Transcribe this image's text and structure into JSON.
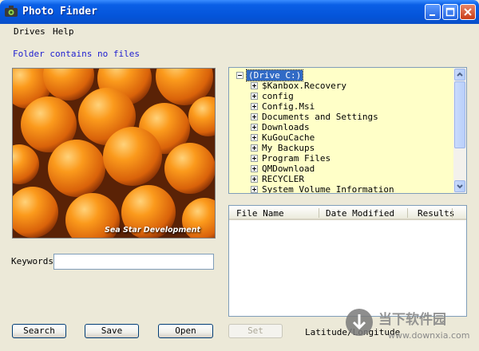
{
  "window": {
    "title": "Photo Finder"
  },
  "menu": {
    "items": [
      "Drives",
      "Help"
    ]
  },
  "status": {
    "text": "Folder contains no files"
  },
  "photo": {
    "caption": "Sea Star Development"
  },
  "keywords": {
    "label": "Keywords",
    "value": ""
  },
  "buttons": {
    "search": "Search",
    "save": "Save",
    "open": "Open",
    "set": "Set"
  },
  "tree": {
    "root": "Drive C:",
    "items": [
      "$Kanbox.Recovery",
      "config",
      "Config.Msi",
      "Documents and Settings",
      "Downloads",
      "KuGouCache",
      "My Backups",
      "Program Files",
      "QMDownload",
      "RECYCLER",
      "System Volume Information"
    ]
  },
  "listview": {
    "columns": [
      "File Name",
      "Date Modified",
      "Results"
    ]
  },
  "location": {
    "label": "Latitude/Longitude"
  },
  "watermark": {
    "text_cn": "当下软件园",
    "url": "www.downxia.com"
  },
  "colors": {
    "titlebar": "#0454D9",
    "status_text": "#2020D0",
    "tree_bg": "#FFFFC8",
    "selection": "#316AC5"
  }
}
